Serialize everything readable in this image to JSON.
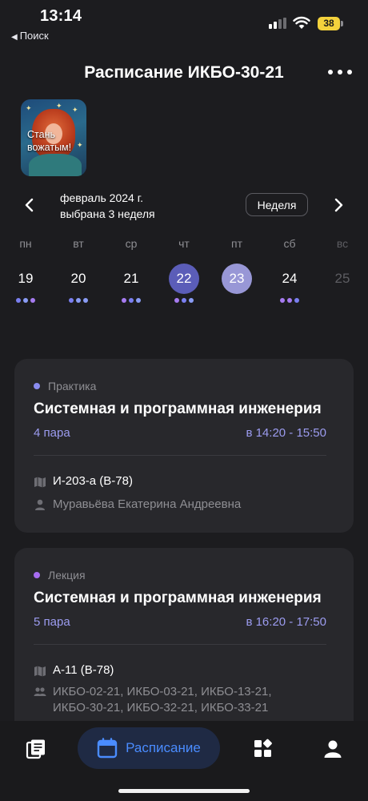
{
  "status_bar": {
    "time": "13:14",
    "back_label": "Поиск",
    "battery": "38"
  },
  "header": {
    "title": "Расписание ИКБО-30-21",
    "more_icon": "ellipsis-icon"
  },
  "story": {
    "text": "Стань вожатым!"
  },
  "week_nav": {
    "month": "февраль 2024 г.",
    "week_label": "выбрана 3 неделя",
    "mode_button": "Неделя"
  },
  "days": [
    {
      "dow": "пн",
      "num": "19",
      "dots": 3
    },
    {
      "dow": "вт",
      "num": "20",
      "dots": 3
    },
    {
      "dow": "ср",
      "num": "21",
      "dots": 3
    },
    {
      "dow": "чт",
      "num": "22",
      "dots": 3,
      "state": "selected"
    },
    {
      "dow": "пт",
      "num": "23",
      "dots": 0,
      "state": "today"
    },
    {
      "dow": "сб",
      "num": "24",
      "dots": 3
    },
    {
      "dow": "вс",
      "num": "25",
      "dots": 0,
      "state": "muted"
    }
  ],
  "lessons": [
    {
      "type": "Практика",
      "type_color": "#8a8cf0",
      "title": "Системная и программная инженерия",
      "pair": "4 пара",
      "time": "в 14:20 - 15:50",
      "room": "И-203-а (В-78)",
      "teacher": "Муравьёва Екатерина Андреевна"
    },
    {
      "type": "Лекция",
      "type_color": "#a66cf0",
      "title": "Системная и программная инженерия",
      "pair": "5 пара",
      "time": "в 16:20 - 17:50",
      "room": "А-11 (В-78)",
      "groups_line1": "ИКБО-02-21, ИКБО-03-21, ИКБО-13-21,",
      "groups_line2": "ИКБО-30-21, ИКБО-32-21, ИКБО-33-21"
    }
  ],
  "tabbar": {
    "active_label": "Расписание",
    "items": [
      "book-icon",
      "calendar-icon",
      "widgets-icon",
      "profile-icon"
    ]
  },
  "colors": {
    "accent": "#4a8cff",
    "selected_day": "#5b5db8",
    "today_day": "#9897d6",
    "card_bg": "#28282c"
  }
}
